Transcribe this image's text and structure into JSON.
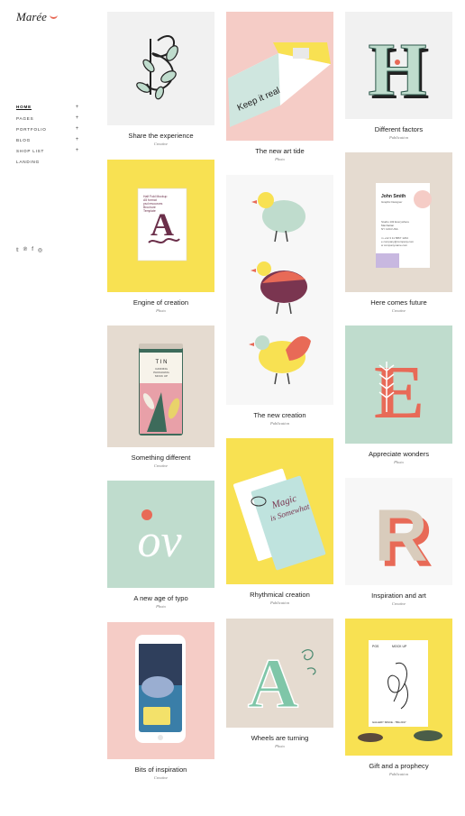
{
  "brand": {
    "name": "Marée"
  },
  "nav": [
    {
      "label": "Home",
      "plus": "+"
    },
    {
      "label": "Pages",
      "plus": "+"
    },
    {
      "label": "Portfolio",
      "plus": "+"
    },
    {
      "label": "Blog",
      "plus": "+"
    },
    {
      "label": "Shop List",
      "plus": "+"
    },
    {
      "label": "Landing",
      "plus": ""
    }
  ],
  "social": {
    "twitter": "𝕥",
    "pinterest": "℗",
    "facebook": "f",
    "instagram": "◎"
  },
  "portfolio": [
    {
      "title": "Share the experience",
      "category": "Creative"
    },
    {
      "title": "The new art tide",
      "category": "Photo"
    },
    {
      "title": "Different factors",
      "category": "Publication"
    },
    {
      "title": "Engine of creation",
      "category": "Photo"
    },
    {
      "title": "The new creation",
      "category": "Publication"
    },
    {
      "title": "Here comes future",
      "category": "Creative"
    },
    {
      "title": "Something different",
      "category": "Creative"
    },
    {
      "title": "Appreciate wonders",
      "category": "Photo"
    },
    {
      "title": "A new age of typo",
      "category": "Photo"
    },
    {
      "title": "Rhythmical creation",
      "category": "Publication"
    },
    {
      "title": "Inspiration and art",
      "category": "Creative"
    },
    {
      "title": "Bits of inspiration",
      "category": "Creative"
    },
    {
      "title": "Wheels are turning",
      "category": "Photo"
    },
    {
      "title": "Gift and a prophecy",
      "category": "Publication"
    }
  ],
  "artwork": {
    "magazine_heading": "Keep it real",
    "brochure": [
      "Half Fold Mockup",
      "A5 format",
      "psd resources",
      "Brochure",
      "Template"
    ],
    "card_name": "John Smith",
    "card_role": "Graphic Designer",
    "card_address": [
      "Studio 132 Everywhere",
      "Manhattan",
      "NY 1234 USA"
    ],
    "card_contact": [
      "m +12 3 11 5867 1234",
      "e company@company.com",
      "w companyname.com"
    ],
    "tin_brand": "T I N",
    "tin_sub": [
      "CANNING",
      "PACKAGING",
      "MOCK UP"
    ],
    "typo_letters": "ov",
    "sign_lines": [
      "Magic",
      "is Somewhat"
    ],
    "poster_tag": "PGS",
    "poster_title": "MOCK UP",
    "poster_footer": "GALLERY SPACE - TBA 2017",
    "letter_h": "H",
    "letter_a_brochure": "A",
    "letter_e": "E",
    "letter_r": "R",
    "letter_a_green": "A"
  },
  "colors": {
    "accent": "#e86a57",
    "pink": "#f5ccc6",
    "yellow": "#f8e152",
    "mint": "#bfdccd",
    "beige": "#e5dbd0",
    "gray": "#f1f1f1"
  }
}
